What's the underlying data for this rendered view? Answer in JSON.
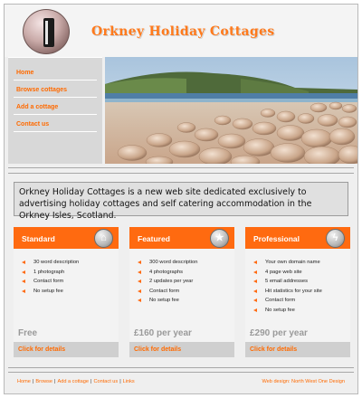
{
  "header": {
    "title": "Orkney Holiday Cottages",
    "logo": "cottage-door-logo"
  },
  "nav": {
    "items": [
      {
        "label": "Home"
      },
      {
        "label": "Browse cottages"
      },
      {
        "label": "Add a cottage"
      },
      {
        "label": "Contact us"
      }
    ]
  },
  "hero": {
    "scene": "beach-with-boulders-and-green-hills"
  },
  "intro": {
    "text": "Orkney Holiday Cottages is a new web site dedicated exclusively to advertising holiday cottages and self catering accommodation in the Orkney Isles, Scotland."
  },
  "plans": [
    {
      "name": "Standard",
      "icon": "house-icon",
      "features": [
        "30 word description",
        "1 photograph",
        "Contact form",
        "No setup fee"
      ],
      "price": "Free",
      "link": "Click for details"
    },
    {
      "name": "Featured",
      "icon": "star-icon",
      "features": [
        "300 word description",
        "4 photographs",
        "2 updates per year",
        "Contact form",
        "No setup fee"
      ],
      "price": "£160 per year",
      "link": "Click for details"
    },
    {
      "name": "Professional",
      "icon": "lightning-icon",
      "features": [
        "Your own domain name",
        "4 page web site",
        "5 email addresses",
        "Hit statistics for your site",
        "Contact form",
        "No setup fee"
      ],
      "price": "£290 per year",
      "link": "Click for details"
    }
  ],
  "footer": {
    "links": [
      "Home",
      "Browse",
      "Add a cottage",
      "Contact us",
      "Links"
    ],
    "separator": "|",
    "credit": "Web design: North West One Design"
  },
  "colors": {
    "accent": "#ff6a10",
    "nav_bg": "#d8d8d8",
    "page_bg": "#efefef"
  }
}
